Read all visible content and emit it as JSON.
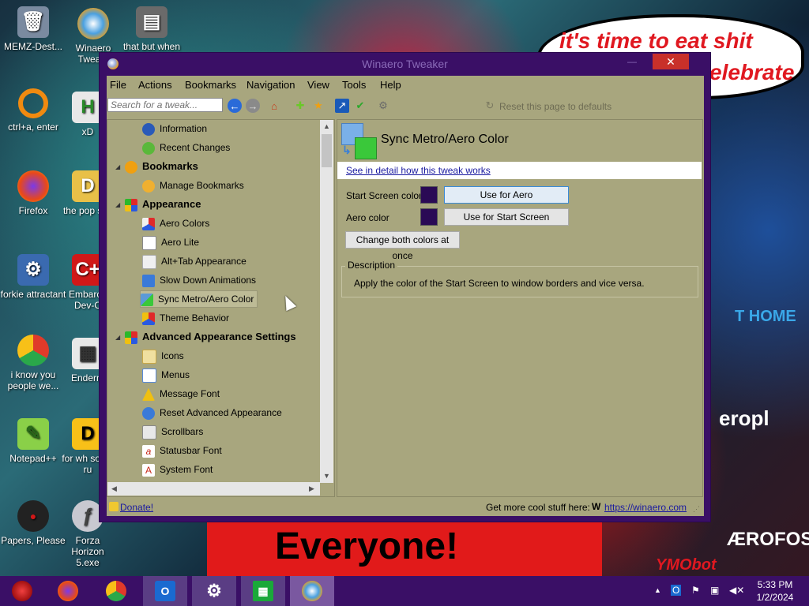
{
  "wallpaper": {
    "bubble_line1": "it's time to eat shit",
    "bubble_line2": "elebrate",
    "banner_text": "Everyone!",
    "sign1": "T HOME",
    "sign2": "eropl",
    "sign3": "ÆROFOS",
    "sign4": "YMObot"
  },
  "desktop_icons": [
    {
      "label": "MEMZ-Dest...",
      "icon": "recycle-bin-icon"
    },
    {
      "label": "Winaero Twea...",
      "icon": "winaero-icon"
    },
    {
      "label": "that but when",
      "icon": "folder-stack-icon"
    },
    {
      "label": "ctrl+a, enter",
      "icon": "ring-icon"
    },
    {
      "label": "xD",
      "icon": "hex-icon"
    },
    {
      "label": "Firefox",
      "icon": "firefox-icon"
    },
    {
      "label": "the pop shit",
      "icon": "document-icon"
    },
    {
      "label": "forkie attractant",
      "icon": "settings-monitor-icon"
    },
    {
      "label": "Embarca Dev-C",
      "icon": "dev-icon"
    },
    {
      "label": "i know you people we...",
      "icon": "chrome-icon"
    },
    {
      "label": "Enderm",
      "icon": "image-icon"
    },
    {
      "label": "Notepad++",
      "icon": "notepad-icon"
    },
    {
      "label": "for wh some ru",
      "icon": "text-icon"
    },
    {
      "label": "Papers, Please",
      "icon": "papers-icon"
    },
    {
      "label": "Forza Horizon 5.exe",
      "icon": "flash-icon"
    }
  ],
  "window": {
    "title": "Winaero Tweaker",
    "close_glyph": "✕",
    "min_glyph": "—",
    "max_glyph": "☐"
  },
  "menu": [
    "File",
    "Actions",
    "Bookmarks",
    "Navigation",
    "View",
    "Tools",
    "Help"
  ],
  "toolbar": {
    "search_placeholder": "Search for a tweak...",
    "reset_label": "Reset this page to defaults"
  },
  "tree": {
    "items": [
      {
        "label": "Information",
        "kind": "child"
      },
      {
        "label": "Recent Changes",
        "kind": "child"
      },
      {
        "label": "Bookmarks",
        "kind": "group"
      },
      {
        "label": "Manage Bookmarks",
        "kind": "child"
      },
      {
        "label": "Appearance",
        "kind": "group"
      },
      {
        "label": "Aero Colors",
        "kind": "child"
      },
      {
        "label": "Aero Lite",
        "kind": "child"
      },
      {
        "label": "Alt+Tab Appearance",
        "kind": "child"
      },
      {
        "label": "Slow Down Animations",
        "kind": "child"
      },
      {
        "label": "Sync Metro/Aero Color",
        "kind": "child",
        "selected": true
      },
      {
        "label": "Theme Behavior",
        "kind": "child"
      },
      {
        "label": "Advanced Appearance Settings",
        "kind": "group"
      },
      {
        "label": "Icons",
        "kind": "child"
      },
      {
        "label": "Menus",
        "kind": "child"
      },
      {
        "label": "Message Font",
        "kind": "child"
      },
      {
        "label": "Reset Advanced Appearance",
        "kind": "child"
      },
      {
        "label": "Scrollbars",
        "kind": "child"
      },
      {
        "label": "Statusbar Font",
        "kind": "child"
      },
      {
        "label": "System Font",
        "kind": "child"
      }
    ]
  },
  "panel": {
    "title": "Sync Metro/Aero Color",
    "detail_link": "See in detail how this tweak works",
    "start_screen_label": "Start Screen color",
    "aero_label": "Aero color",
    "use_for_aero": "Use for Aero",
    "use_for_start": "Use for Start Screen",
    "change_both": "Change both colors at once",
    "description_caption": "Description",
    "description_text": "Apply the color of the Start Screen to window borders and vice versa.",
    "swatch_color": "#2a0a55"
  },
  "statusbar": {
    "donate": "Donate!",
    "get_more": "Get more cool stuff here:",
    "winaero_glyph": "W",
    "url": "https://winaero.com"
  },
  "taskbar": {
    "apps": [
      "start-orb-icon",
      "firefox-icon",
      "chrome-icon",
      "outlook-icon",
      "settings-icon",
      "store-icon",
      "winaero-icon"
    ],
    "time": "5:33 PM",
    "date": "1/2/2024"
  }
}
